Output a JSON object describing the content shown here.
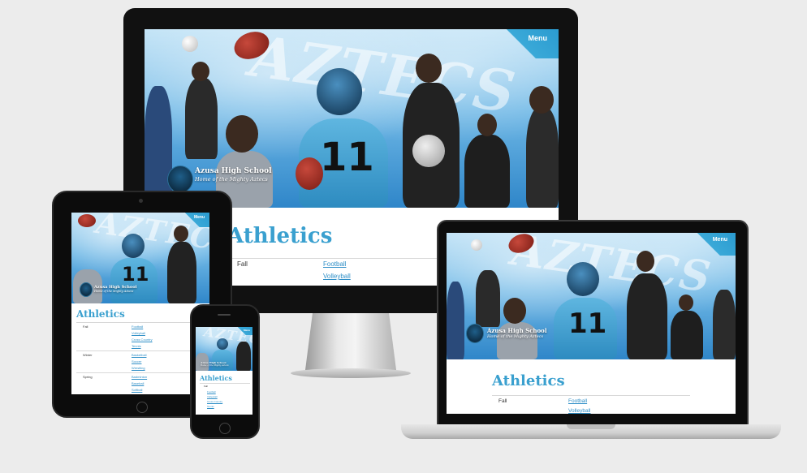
{
  "site": {
    "menu_label": "Menu",
    "school_name": "Azusa High School",
    "tagline": "Home of the Mighty Aztecs",
    "watermark": "AZTECS",
    "jersey_number": "11",
    "page_heading": "Athletics"
  },
  "seasons": [
    {
      "name": "Fall",
      "sports": [
        "Football",
        "Volleyball",
        "Cross Country",
        "Tennis"
      ]
    },
    {
      "name": "Winter",
      "sports": [
        "Basketball",
        "Soccer",
        "Wrestling"
      ]
    },
    {
      "name": "Spring",
      "sports": [
        "Badminton",
        "Baseball",
        "Softball"
      ]
    }
  ],
  "colors": {
    "accent": "#3aa0cf",
    "link": "#2f8fc7",
    "background": "#ececec",
    "device_black": "#111111"
  }
}
